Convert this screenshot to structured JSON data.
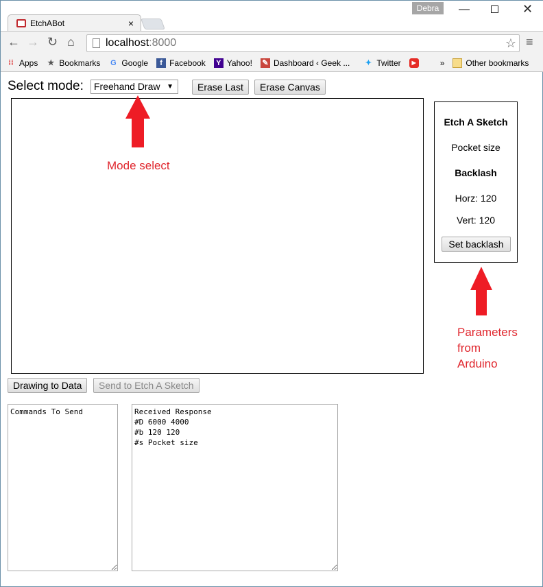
{
  "browser": {
    "user": "Debra",
    "tab_title": "EtchABot",
    "url_host": "localhost",
    "url_port": ":8000",
    "bookmarks": [
      "Apps",
      "Bookmarks",
      "Google",
      "Facebook",
      "Yahoo!",
      "Dashboard ‹ Geek ...",
      "Twitter",
      "»",
      "Other bookmarks"
    ]
  },
  "page": {
    "mode_label": "Select mode:",
    "mode_selected": "Freehand Draw",
    "erase_last": "Erase Last",
    "erase_canvas": "Erase Canvas",
    "drawing_to_data": "Drawing to Data",
    "send_to_etch": "Send to Etch A Sketch",
    "commands_text": "Commands To Send",
    "response_text": "Received Response\n#D 6000 4000\n#b 120 120\n#s Pocket size",
    "params": {
      "device": "Etch A Sketch",
      "size": "Pocket size",
      "backlash_heading": "Backlash",
      "horz": "Horz: 120",
      "vert": "Vert: 120",
      "set_backlash": "Set backlash"
    }
  },
  "annotations": {
    "mode_select": "Mode select",
    "parameters_line1": "Parameters",
    "parameters_line2": "from",
    "parameters_line3": "Arduino",
    "color": "#e0262d"
  }
}
